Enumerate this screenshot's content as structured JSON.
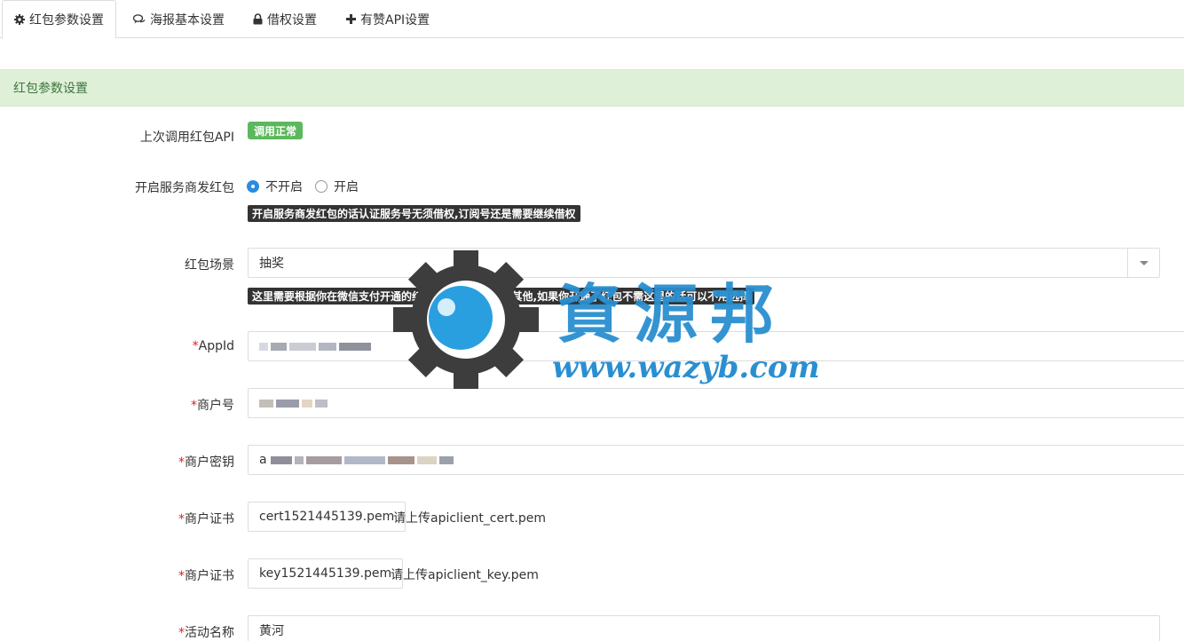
{
  "tabs": [
    {
      "label": "红包参数设置",
      "icon": "gear-icon"
    },
    {
      "label": "海报基本设置",
      "icon": "comments-icon"
    },
    {
      "label": "借权设置",
      "icon": "lock-icon"
    },
    {
      "label": "有赞API设置",
      "icon": "plus-icon"
    }
  ],
  "panel": {
    "title": "红包参数设置"
  },
  "fields": {
    "api_status": {
      "label": "上次调用红包API",
      "badge": "调用正常"
    },
    "service_redpack": {
      "label": "开启服务商发红包",
      "options": [
        "不开启",
        "开启"
      ],
      "selected": "不开启",
      "hint": "开启服务商发红包的话认证服务号无须借权,订阅号还是需要继续借权"
    },
    "scene": {
      "label": "红包场景",
      "value": "抽奖",
      "hint": "这里需要根据你在微信支付开通的红包场景选择,默认是其他,如果你开通了红包不需这里的话可以不用选择"
    },
    "appid": {
      "required": "*",
      "label": "AppId"
    },
    "mch_id": {
      "required": "*",
      "label": "商户号"
    },
    "mch_key": {
      "required": "*",
      "label": "商户密钥",
      "value_prefix": "a"
    },
    "cert": {
      "required": "*",
      "label": "商户证书",
      "file": "cert1521445139.pem",
      "hint": "请上传apiclient_cert.pem"
    },
    "key": {
      "required": "*",
      "label": "商户证书",
      "file": "key1521445139.pem",
      "hint": "请上传apiclient_key.pem"
    },
    "act_name": {
      "required": "*",
      "label": "活动名称",
      "value": "黄河"
    }
  },
  "watermark": {
    "text": "資源邦",
    "url": "www.wazyb.com"
  },
  "colors": {
    "success": "#5cb85c",
    "panel_bg": "#dff0d8",
    "panel_text": "#3c763d",
    "accent": "#2b8ae2",
    "watermark": "#2a8fd0"
  }
}
